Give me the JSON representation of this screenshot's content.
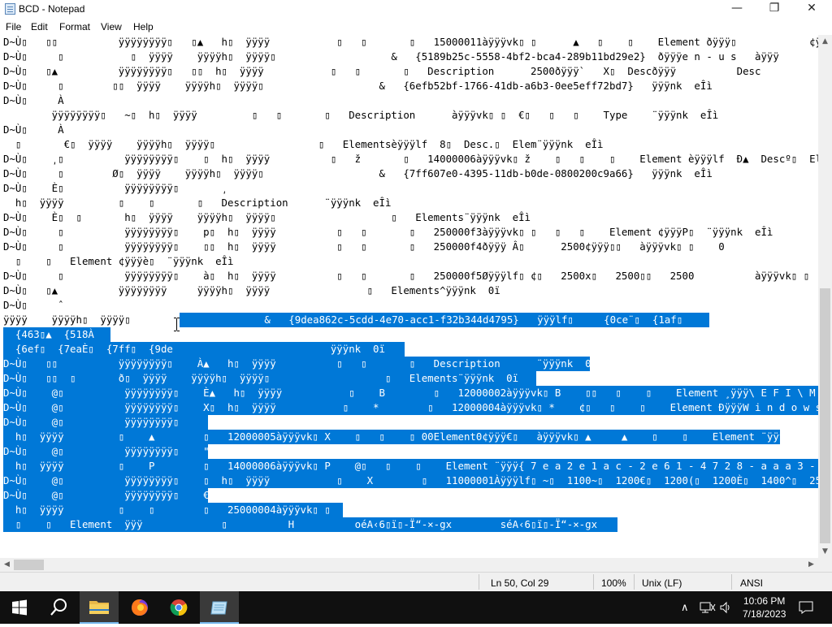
{
  "window": {
    "title": "BCD - Notepad",
    "controls": {
      "minimize": "—",
      "maximize": "❐",
      "close": "✕"
    }
  },
  "menu": [
    "File",
    "Edit",
    "Format",
    "View",
    "Help"
  ],
  "editor": {
    "lines": [
      {
        "text": "D~Ù▯   ▯▯          ÿÿÿÿÿÿÿÿ▯   ▯▲   h▯  ÿÿÿÿ           ▯   ▯       ▯   15000011àÿÿÿvk▯ ▯      ▲   ▯    ▯    Element ðÿÿÿ▯            ¢ÿÿÿà▯"
      },
      {
        "text": "D~Ù▯     ▯           ▯  ÿÿÿÿ    ÿÿÿÿh▯  ÿÿÿÿ▯                   &   {5189b25c-5558-4bf2-bca4-289b11bd29e2}  ðÿÿÿe n - u s   àÿÿÿ"
      },
      {
        "text": "D~Ù▯   ▯▲          ÿÿÿÿÿÿÿÿ▯   ▯▯  h▯  ÿÿÿÿ           ▯   ▯       ▯   Description      2500ðÿÿÿ`   X▯  Descðÿÿÿ          Desc"
      },
      {
        "text": "D~Ù▯     ▯        ▯▯  ÿÿÿÿ    ÿÿÿÿh▯  ÿÿÿÿ▯                   &   {6efb52bf-1766-41db-a6b3-0ee5eff72bd7}   ÿÿÿnk  eÎì"
      },
      {
        "text": "D~Ù▯     À"
      },
      {
        "text": "        ÿÿÿÿÿÿÿÿ▯   ~▯  h▯  ÿÿÿÿ         ▯   ▯       ▯   Description      àÿÿÿvk▯ ▯  €▯   ▯   ▯    Type    ¨ÿÿÿnk  eÎì"
      },
      {
        "text": "D~Ù▯     À"
      },
      {
        "text": "  ▯       €▯  ÿÿÿÿ    ÿÿÿÿh▯  ÿÿÿÿ▯                 ▯   Elementsèÿÿÿlf  8▯  Desc.▯  Elem¨ÿÿÿnk  eÎì"
      },
      {
        "text": "D~Ù▯    ͵▯          ÿÿÿÿÿÿÿÿ▯    ▯  h▯  ÿÿÿÿ          ▯   ž       ▯   14000006àÿÿÿvk▯ ž    ▯   ▯    ▯    Element èÿÿÿlf  Ð▲  Descº▯  Eler"
      },
      {
        "text": "D~Ù▯     ▯        Ø▯  ÿÿÿÿ    ÿÿÿÿh▯  ÿÿÿÿ▯                   &   {7ff607e0-4395-11db-b0de-0800200c9a66}   ÿÿÿnk  eÎì"
      },
      {
        "text": "D~Ù▯    È▯          ÿÿÿÿÿÿÿÿ▯       ͵"
      },
      {
        "text": "  h▯  ÿÿÿÿ         ▯    ▯       ▯   Description      ¨ÿÿÿnk  eÎì"
      },
      {
        "text": "D~Ù▯    È▯  ▯       h▯  ÿÿÿÿ    ÿÿÿÿh▯  ÿÿÿÿ▯                   ▯   Elements¨ÿÿÿnk  eÎì"
      },
      {
        "text": "D~Ù▯     ▯          ÿÿÿÿÿÿÿÿ▯    p▯  h▯  ÿÿÿÿ          ▯   ▯       ▯   250000f3àÿÿÿvk▯ ▯   ▯   ▯    Element ¢ÿÿÿP▯  ¨ÿÿÿnk  eÎì"
      },
      {
        "text": "D~Ù▯     ▯          ÿÿÿÿÿÿÿÿ▯    ▯▯  h▯  ÿÿÿÿ          ▯   ▯       ▯   250000f4ðÿÿÿ Â▯      2500¢ÿÿÿ▯▯   àÿÿÿvk▯ ▯    0"
      },
      {
        "text": "  ▯    ▯   Element ¢ÿÿÿè▯  ¨ÿÿÿnk  eÎì"
      },
      {
        "text": "D~Ù▯     ▯          ÿÿÿÿÿÿÿÿ▯    à▯  h▯  ÿÿÿÿ          ▯   ▯       ▯   250000f5Øÿÿÿlf▯ ¢▯   2500x▯   2500▯▯   2500          àÿÿÿvk▯ ▯    Ð▯  ▯"
      },
      {
        "text": "D~Ù▯   ▯▲          ÿÿÿÿÿÿÿÿ     ÿÿÿÿh▯  ÿÿÿÿ                ▯   Elements^ÿÿÿnk  0ï"
      },
      {
        "text": "D~Ù▯     ˆ"
      },
      {
        "text": "ÿÿÿÿ    ÿÿÿÿh▯  ÿÿÿÿ▯"
      },
      {
        "text": ""
      },
      {
        "text": "  {6ef▯  {7eaÈ▯  {7ff▯  {9de"
      },
      {
        "text": "D~Ù▯   ▯▯          ÿÿÿÿÿÿÿÿ▯    À▲   h▯  ÿÿÿÿ          ▯   ▯       ▯   Description      ¨ÿÿÿnk  0ï"
      },
      {
        "text": "D~Ù▯   ▯▯  ▯       ð▯  ÿÿÿÿ    ÿÿÿÿh▯  ÿÿÿÿ▯                   ▯   Elements¨ÿÿÿnk  0ï"
      },
      {
        "text": "D~Ù▯    @▯          ÿÿÿÿÿÿÿÿ▯    È▲   h▯  ÿÿÿÿ           ▯    B        ▯   12000002àÿÿÿvk▯ B    ▯▯   ▯    ▯    Element ¸ÿÿÿ\\ E F I \\ M i c r o"
      },
      {
        "text": "D~Ù▯    @▯          ÿÿÿÿÿÿÿÿ▯    X▯  h▯  ÿÿÿÿ           ▯    *        ▯   12000004àÿÿÿvk▯ *    ¢▯   ▯    ▯    Element ÐÿÿÿW i n d o w s   B o"
      },
      {
        "text": "D~Ù▯    @▯          ÿÿÿÿÿÿÿÿ▯"
      },
      {
        "text": "  h▯  ÿÿÿÿ         ▯    ▲        ▯   12000005àÿÿÿvk▯ X    ▯   ▯    ▯ 00Element0¢ÿÿÿ€▯   àÿÿÿvk▯ ▲     ▲    ▯    ▯    Element ¨ÿÿÿnk  eÎì"
      },
      {
        "text": "D~Ù▯    @▯          ÿÿÿÿÿÿÿÿ▯    \""
      },
      {
        "text": "  h▯  ÿÿÿÿ         ▯    P        ▯   14000006àÿÿÿvk▯ P    @▯   ▯    ▯    Element ¨ÿÿÿ{ 7 e a 2 e 1 a c - 2 e 6 1 - 4 7 2 8 - a a a 3 - 8"
      },
      {
        "text": "D~Ù▯    @▯          ÿÿÿÿÿÿÿÿ▯    ▯  h▯  ÿÿÿÿ           ▯    X        ▯   11000001Àÿÿÿlf▯ ~▯  1100~▯  1200€▯  1200(▯  1200È▯  1400^▯  2500"
      },
      {
        "text": "D~Ù▯    @▯          ÿÿÿÿÿÿÿÿ▯    €"
      },
      {
        "text": "  h▯  ÿÿÿÿ         ▯    ▯        ▯   25000004àÿÿÿvk▯ ▯   P"
      },
      {
        "text": "  ▯    ▯   Element  ÿÿÿ             ▯          H          oéA‹6▯ï▯-Ï“-×-gx        séA‹6▯ï▯-Ï“-×-gx                     ▯"
      }
    ],
    "partial_lines": {
      "line20_unselected": "ÿÿÿÿ    ÿÿÿÿh▯  ÿÿÿÿ▯",
      "line20_selected": "              &   {9dea862c-5cdd-4e70-acc1-f32b344d4795}   ÿÿÿlf▯     {0ce¨▯  {1af▯",
      "line21_selected": "  {463▯▲  {518À",
      "line22_selected": "  {6ef▯  {7eaÈ▯  {7ff▯  {9de                          ÿÿÿnk  0ï"
    }
  },
  "status": {
    "position": "Ln 50, Col 29",
    "zoom": "100%",
    "line_ending": "Unix (LF)",
    "encoding": "ANSI"
  },
  "taskbar": {
    "time": "10:06 PM",
    "date": "7/18/2023"
  },
  "colors": {
    "selection": "#0078d7",
    "taskbar": "#101010"
  }
}
